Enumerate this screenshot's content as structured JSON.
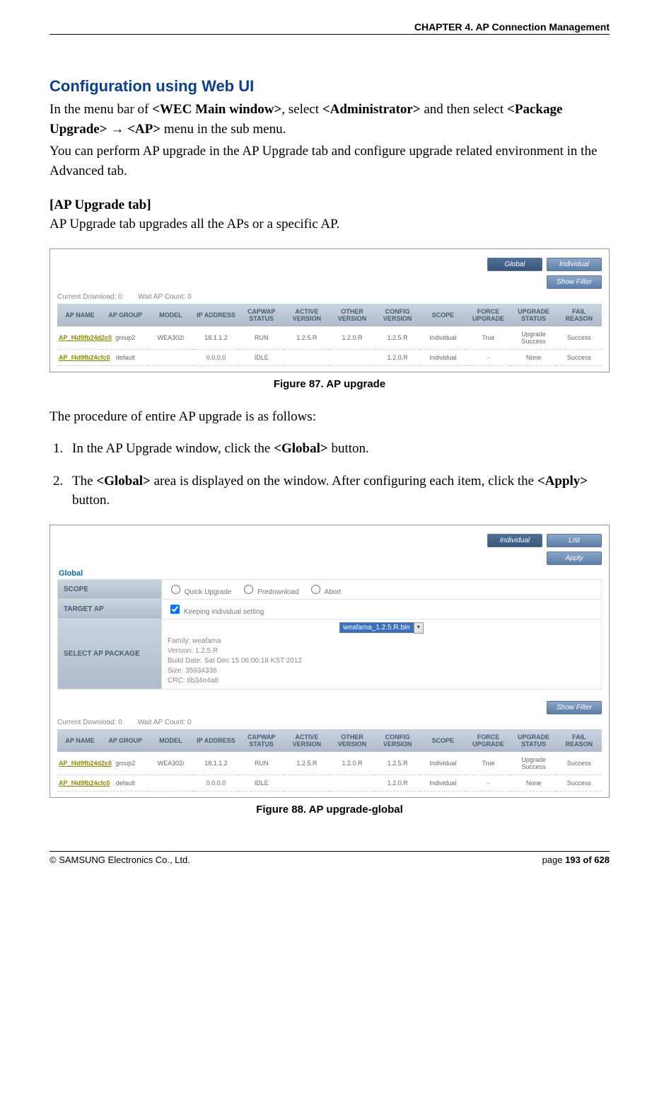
{
  "header": {
    "chapter": "CHAPTER 4. AP Connection Management"
  },
  "section": {
    "title": "Configuration using Web UI",
    "intro1_a": "In the menu bar of ",
    "intro1_b": "<WEC Main window>",
    "intro1_c": ", select ",
    "intro1_d": "<Administrator>",
    "intro1_e": " and then select ",
    "intro2_a": "<Package Upgrade>",
    "intro2_b": " → ",
    "intro2_c": "<AP>",
    "intro2_d": " menu in the sub menu.",
    "intro3": "You can perform AP upgrade in the AP Upgrade tab and configure upgrade related environment in the Advanced tab.",
    "sub_head": "[AP Upgrade tab]",
    "sub_desc": "AP Upgrade tab upgrades all the APs or a specific AP."
  },
  "fig87": {
    "caption": "Figure 87. AP upgrade",
    "btn_global": "Global",
    "btn_individual": "Individual",
    "btn_show_filter": "Show Filter",
    "status_dl": "Current Download: 0",
    "status_wait": "Wait AP Count: 0",
    "columns": [
      "AP NAME",
      "AP GROUP",
      "MODEL",
      "IP ADDRESS",
      "CAPWAP STATUS",
      "ACTIVE VERSION",
      "OTHER VERSION",
      "CONFIG VERSION",
      "SCOPE",
      "FORCE UPGRADE",
      "UPGRADE STATUS",
      "FAIL REASON"
    ],
    "rows": [
      {
        "name": "AP_f4d9fb24d2c0",
        "group": "group2",
        "model": "WEA302i",
        "ip": "18.1.1.2",
        "cap": "RUN",
        "act": "1.2.5.R",
        "oth": "1.2.0.R",
        "cfg": "1.2.5.R",
        "scope": "Individual",
        "force": "True",
        "ustat": "Upgrade Success",
        "fail": "Success"
      },
      {
        "name": "AP_f4d9fb24cfc0",
        "group": "default",
        "model": "",
        "ip": "0.0.0.0",
        "cap": "IDLE",
        "act": "",
        "oth": "",
        "cfg": "1.2.0.R",
        "scope": "Individual",
        "force": "-",
        "ustat": "None",
        "fail": "Success"
      }
    ]
  },
  "procedure": {
    "intro": "The procedure of entire AP upgrade is as follows:",
    "step1_a": "In the AP Upgrade window, click the ",
    "step1_b": "<Global>",
    "step1_c": " button.",
    "step2_a": "The ",
    "step2_b": "<Global>",
    "step2_c": " area is displayed on the window. After configuring each item, click the ",
    "step2_d": "<Apply>",
    "step2_e": " button."
  },
  "fig88": {
    "caption": "Figure 88. AP upgrade-global",
    "btn_individual": "Individual",
    "btn_list": "List",
    "btn_apply": "Apply",
    "global_label": "Global",
    "form": {
      "scope_label": "SCOPE",
      "scope_opts": [
        "Quick Upgrade",
        "Predownload",
        "Abort"
      ],
      "target_label": "TARGET AP",
      "target_chk": "Keeping individual setting",
      "pkg_label": "SELECT AP PACKAGE",
      "pkg_file": "weafama_1.2.5.R.bin",
      "pkg_meta": [
        "Family: weafama",
        "Version: 1.2.5.R",
        "Build Date: Sat Dec 15 06:00:18 KST 2012",
        "Size: 35934336",
        "CRC: 6b34e4a8"
      ]
    },
    "btn_show_filter": "Show Filter",
    "status_dl": "Current Download: 0",
    "status_wait": "Wait AP Count: 0",
    "columns": [
      "AP NAME",
      "AP GROUP",
      "MODEL",
      "IP ADDRESS",
      "CAPWAP STATUS",
      "ACTIVE VERSION",
      "OTHER VERSION",
      "CONFIG VERSION",
      "SCOPE",
      "FORCE UPGRADE",
      "UPGRADE STATUS",
      "FAIL REASON"
    ],
    "rows": [
      {
        "name": "AP_f4d9fb24d2c0",
        "group": "group2",
        "model": "WEA302i",
        "ip": "18.1.1.2",
        "cap": "RUN",
        "act": "1.2.5.R",
        "oth": "1.2.0.R",
        "cfg": "1.2.5.R",
        "scope": "Individual",
        "force": "True",
        "ustat": "Upgrade Success",
        "fail": "Success"
      },
      {
        "name": "AP_f4d9fb24cfc0",
        "group": "default",
        "model": "",
        "ip": "0.0.0.0",
        "cap": "IDLE",
        "act": "",
        "oth": "",
        "cfg": "1.2.0.R",
        "scope": "Individual",
        "force": "-",
        "ustat": "None",
        "fail": "Success"
      }
    ]
  },
  "footer": {
    "left": "© SAMSUNG Electronics Co., Ltd.",
    "right_a": "page ",
    "right_b": "193 of 628"
  }
}
